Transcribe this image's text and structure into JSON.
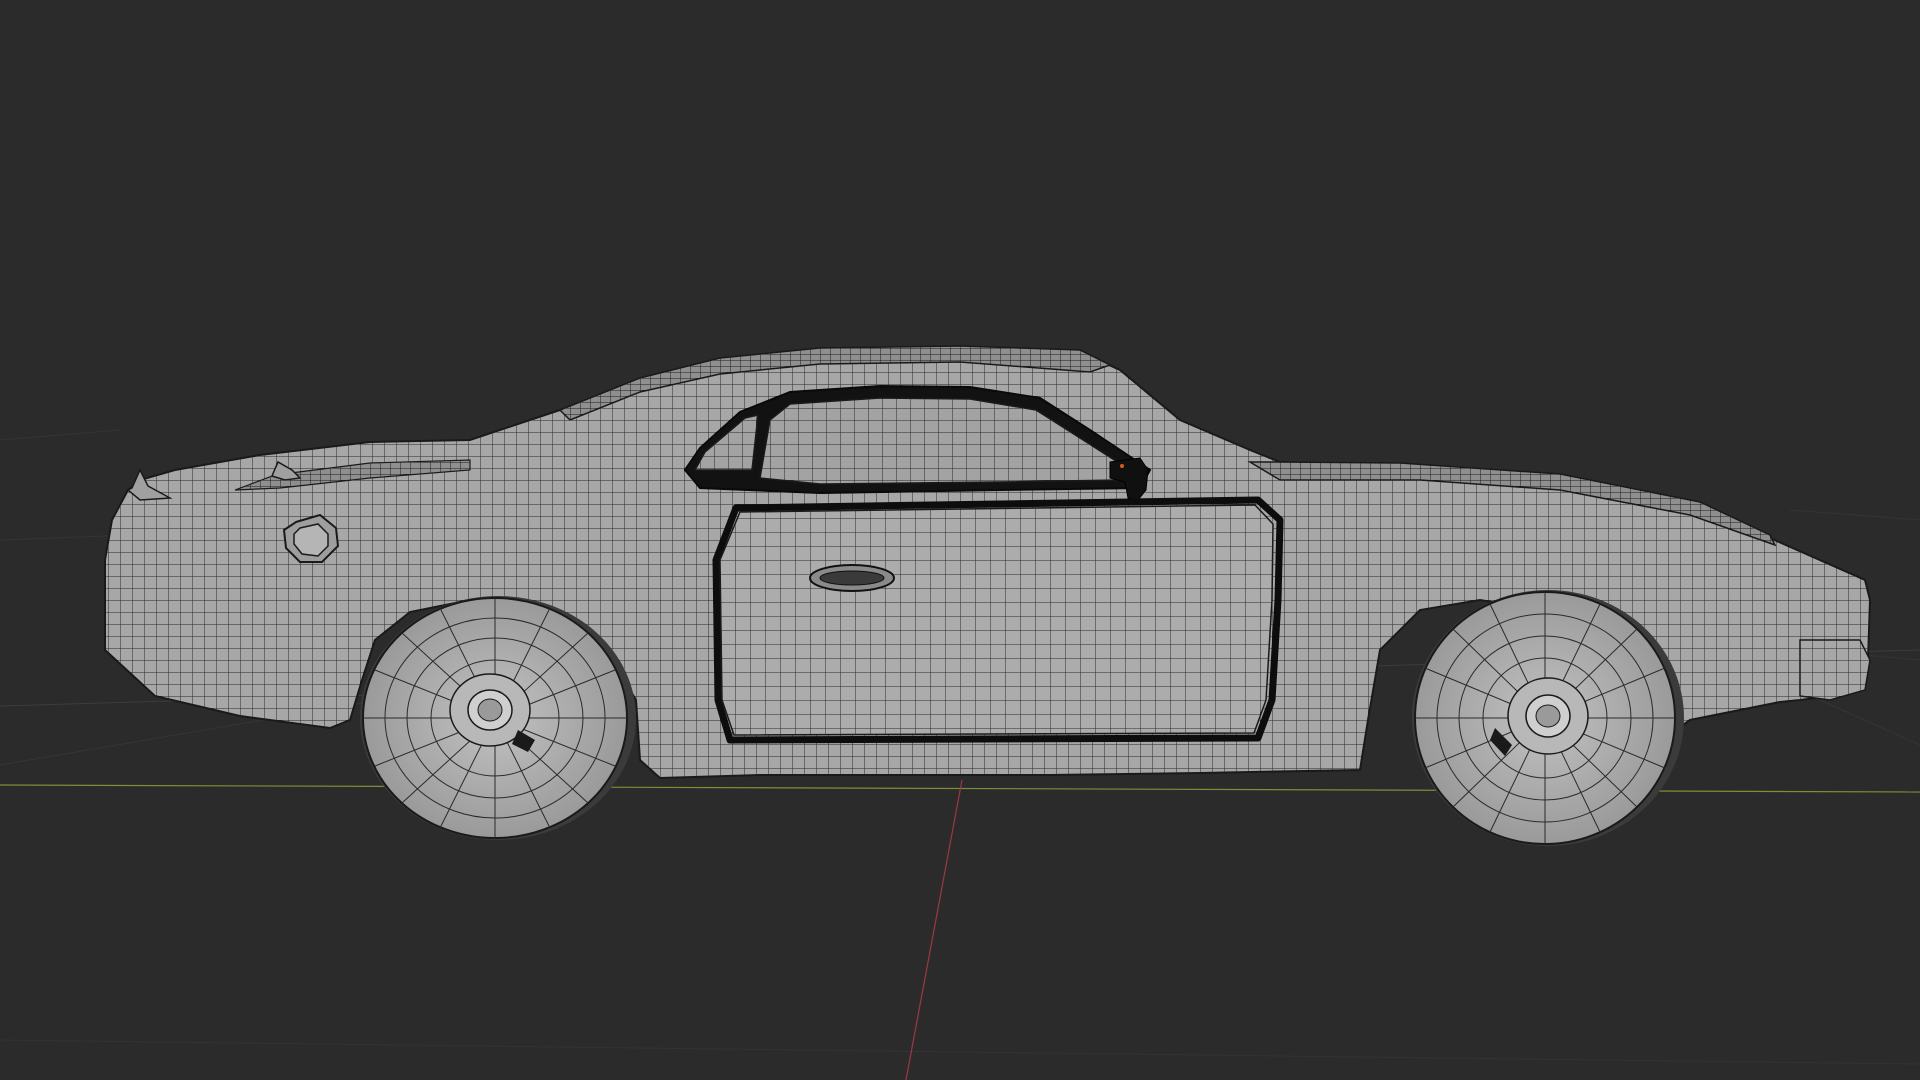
{
  "viewport": {
    "mode": "3d-viewport",
    "shading": "wireframe-overlay",
    "background_color": "#2b2b2b",
    "grid_color": "#3a3a3a",
    "x_axis_color": "#8a9a3a",
    "y_axis_color": "#9a3a44"
  },
  "scene": {
    "object": "car-body-mesh",
    "mesh_fill_color": "#a9a9a9",
    "mesh_wire_color": "#1a1a1a",
    "window_fill_color": "#9c9c9c",
    "components": [
      "car-body",
      "cabin-window",
      "door-panel",
      "door-handle",
      "side-mirror",
      "fuel-cap",
      "rear-spoiler",
      "rear-wheel",
      "front-wheel"
    ]
  }
}
